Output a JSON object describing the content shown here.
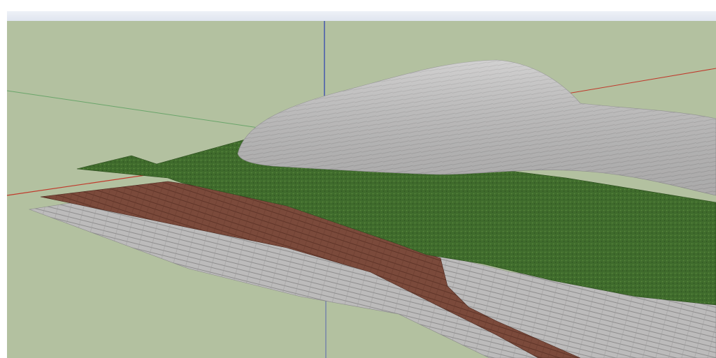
{
  "app": {
    "window_title": "",
    "viewport_background": "#b3c1a0"
  },
  "scene": {
    "axes": {
      "red": "#c0392b",
      "green": "#5aa05a",
      "blue": "#2a3fb0"
    },
    "materials": {
      "grass": "#3f6a2d",
      "soil": "#7a4a3a",
      "rock": "#bdbcbc"
    }
  }
}
